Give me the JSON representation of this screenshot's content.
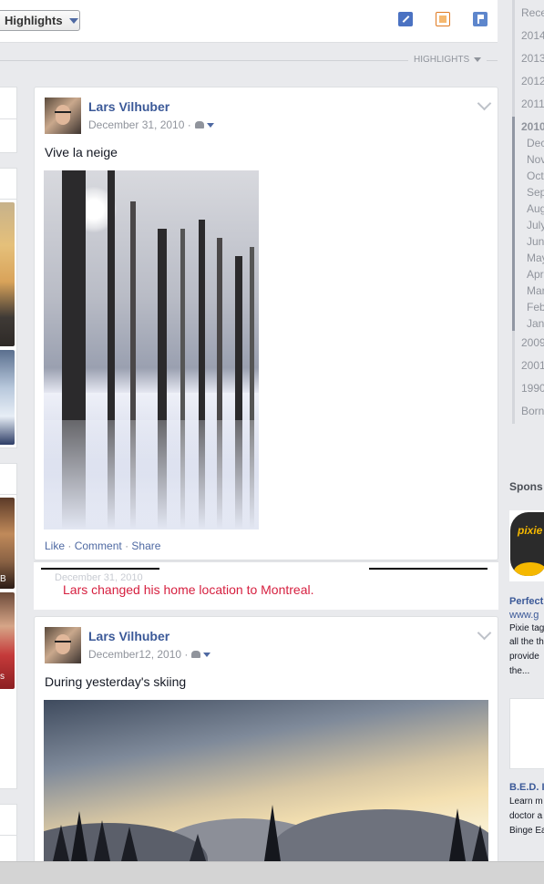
{
  "header": {
    "highlights_button": "Highlights",
    "section_label": "HIGHLIGHTS"
  },
  "posts": [
    {
      "author": "Lars Vilhuber",
      "date": "December 31, 2010 ·",
      "text": "Vive la neige",
      "actions": [
        "Like",
        "Comment",
        "Share"
      ]
    },
    {
      "author": "Lars Vilhuber",
      "date": "December12, 2010 ·",
      "text": "During yesterday's skiing"
    }
  ],
  "life_event": {
    "date": "December 31, 2010",
    "text": "Lars changed his home location to Montreal."
  },
  "timeline_nav": {
    "recent": "Rece",
    "years_top": [
      "2014",
      "2013",
      "2012",
      "2011"
    ],
    "active_year": "2010",
    "months": [
      "Dec",
      "Nov",
      "Oct",
      "Sep",
      "Aug",
      "July",
      "Jun",
      "May",
      "Apr",
      "Mar",
      "Feb",
      "Jan"
    ],
    "years_bottom": [
      "2009",
      "2001",
      "1990"
    ],
    "born": "Born"
  },
  "sponsored": {
    "title": "Spons",
    "ad1": {
      "logo": "pixie",
      "title": "Perfect",
      "url": "www.g",
      "lines": [
        "Pixie tag",
        "all the th",
        "provide",
        "the..."
      ]
    },
    "ad2": {
      "title": "B.E.D. In",
      "lines": [
        "Learn m",
        "doctor a",
        "Binge Ea"
      ]
    }
  },
  "left_sliver": {
    "caption_b": "B",
    "caption_s": "s"
  },
  "colors": {
    "link": "#3b5998",
    "event": "#d61f3f",
    "background": "#e9eaed"
  }
}
